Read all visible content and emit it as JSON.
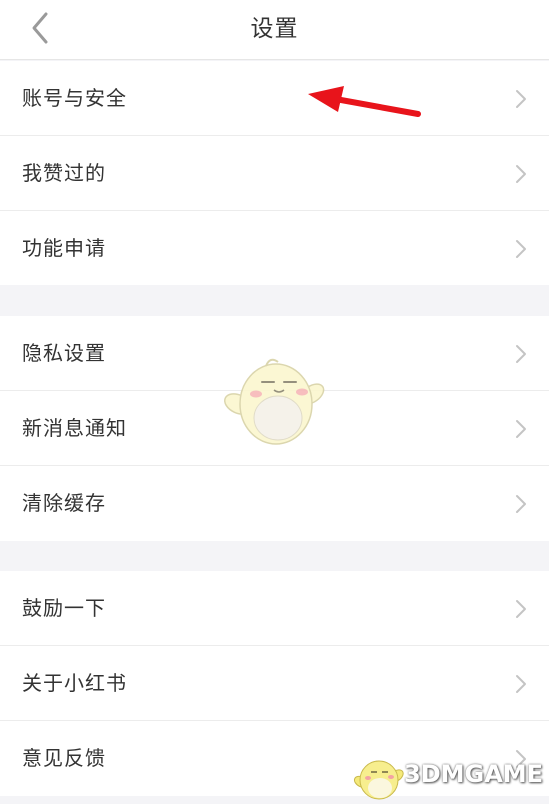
{
  "header": {
    "title": "设置"
  },
  "groups": [
    {
      "items": [
        {
          "label": "账号与安全"
        },
        {
          "label": "我赞过的"
        },
        {
          "label": "功能申请"
        }
      ]
    },
    {
      "items": [
        {
          "label": "隐私设置"
        },
        {
          "label": "新消息通知"
        },
        {
          "label": "清除缓存"
        }
      ]
    },
    {
      "items": [
        {
          "label": "鼓励一下"
        },
        {
          "label": "关于小红书"
        },
        {
          "label": "意见反馈"
        }
      ]
    }
  ],
  "annotation": {
    "arrow_color": "#e8141b"
  },
  "watermark": {
    "text": "3DMGAME"
  },
  "colors": {
    "background": "#f4f4f7",
    "row_bg": "#ffffff",
    "text": "#333333",
    "chevron": "#c4c4c4"
  }
}
